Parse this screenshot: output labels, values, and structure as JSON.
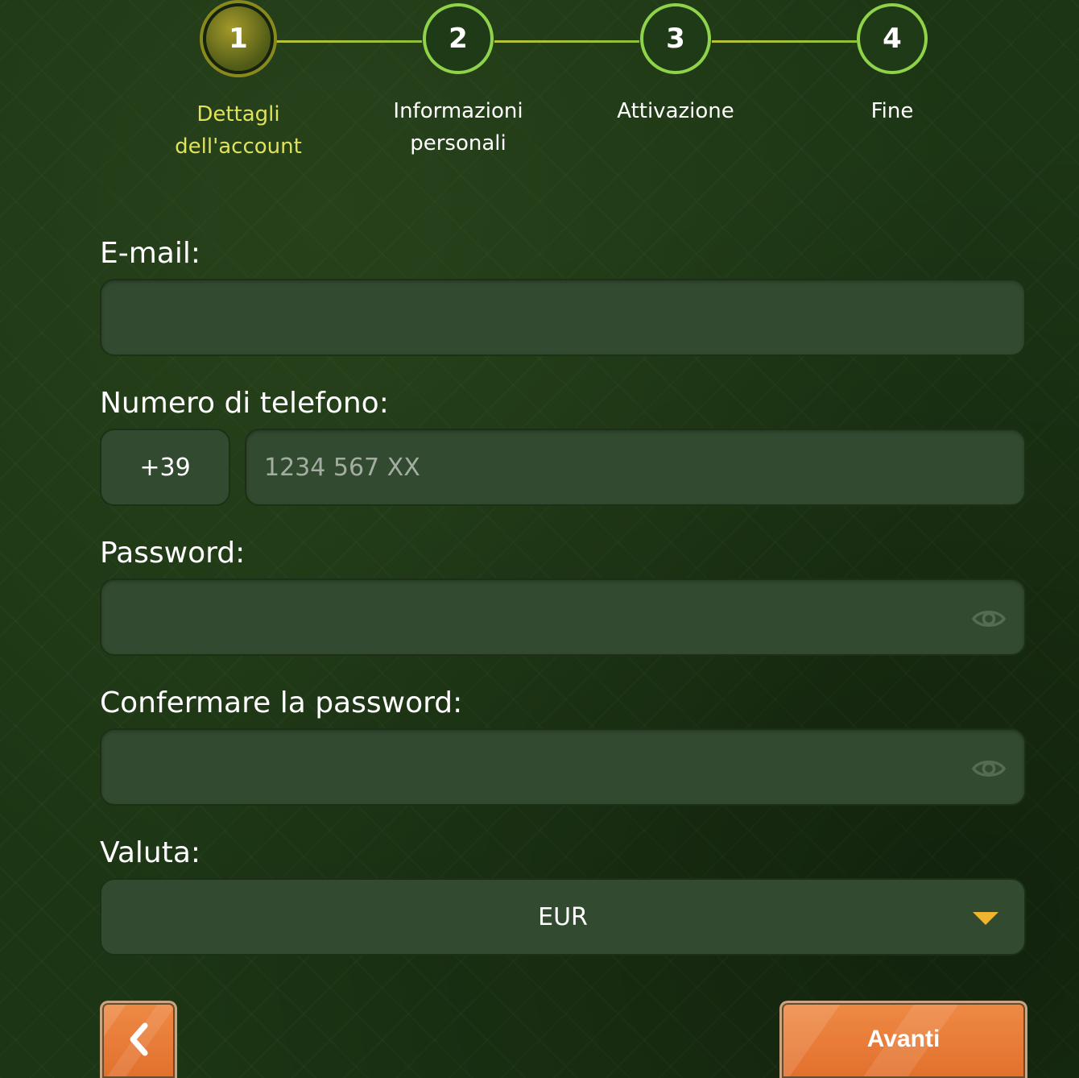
{
  "stepper": {
    "steps": [
      {
        "number": "1",
        "label_line1": "Dettagli",
        "label_line2": "dell'account",
        "active": true
      },
      {
        "number": "2",
        "label_line1": "Informazioni",
        "label_line2": "personali",
        "active": false
      },
      {
        "number": "3",
        "label_line1": "Attivazione",
        "label_line2": "",
        "active": false
      },
      {
        "number": "4",
        "label_line1": "Fine",
        "label_line2": "",
        "active": false
      }
    ]
  },
  "form": {
    "email": {
      "label": "E-mail:",
      "value": "",
      "placeholder": ""
    },
    "phone": {
      "label": "Numero di telefono:",
      "prefix": "+39",
      "value": "",
      "placeholder": "1234 567 XX"
    },
    "password": {
      "label": "Password:",
      "value": "",
      "placeholder": "",
      "toggle_icon": "eye-icon"
    },
    "confirm_password": {
      "label": "Confermare la password:",
      "value": "",
      "placeholder": "",
      "toggle_icon": "eye-icon"
    },
    "currency": {
      "label": "Valuta:",
      "selected": "EUR",
      "caret_icon": "chevron-down-icon"
    }
  },
  "buttons": {
    "back_icon": "chevron-left-icon",
    "next_label": "Avanti"
  },
  "colors": {
    "accent_orange": "#e97b37",
    "active_step_label": "#dfe25a",
    "step_border": "#8fd34a",
    "caret": "#f0b431",
    "field_bg": "#324b30"
  }
}
